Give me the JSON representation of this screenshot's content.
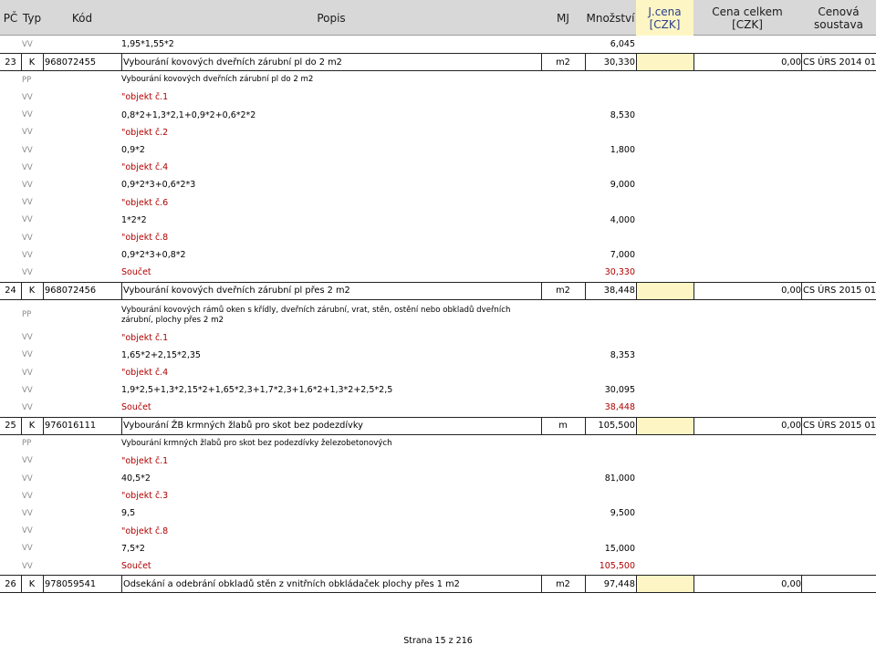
{
  "header": {
    "pc": "PČ",
    "typ": "Typ",
    "kod": "Kód",
    "popis": "Popis",
    "mj": "MJ",
    "mnozstvi": "Množství",
    "jcena": [
      "J.cena",
      "[CZK]"
    ],
    "cena_celkem": [
      "Cena celkem",
      "[CZK]"
    ],
    "cenova_soustava": [
      "Cenová",
      "soustava"
    ]
  },
  "rows": [
    {
      "kind": "vv",
      "tag": "VV",
      "text": "1,95*1,55*2",
      "qty": "6,045"
    },
    {
      "kind": "item",
      "pc": "23",
      "typ": "K",
      "kod": "968072455",
      "popis": "Vybourání kovových dveřních zárubní pl do 2 m2",
      "mj": "m2",
      "qty": "30,330",
      "total": "0,00",
      "system": "CS ÚRS 2014 01"
    },
    {
      "kind": "pp",
      "tag": "PP",
      "text": "Vybourání kovových dveřních zárubní pl do 2 m2"
    },
    {
      "kind": "obj",
      "tag": "VV",
      "text": "\"objekt č.1"
    },
    {
      "kind": "vv",
      "tag": "VV",
      "text": "0,8*2+1,3*2,1+0,9*2+0,6*2*2",
      "qty": "8,530"
    },
    {
      "kind": "obj",
      "tag": "VV",
      "text": "\"objekt č.2"
    },
    {
      "kind": "vv",
      "tag": "VV",
      "text": "0,9*2",
      "qty": "1,800"
    },
    {
      "kind": "obj",
      "tag": "VV",
      "text": "\"objekt č.4"
    },
    {
      "kind": "vv",
      "tag": "VV",
      "text": "0,9*2*3+0,6*2*3",
      "qty": "9,000"
    },
    {
      "kind": "obj",
      "tag": "VV",
      "text": "\"objekt č.6"
    },
    {
      "kind": "vv",
      "tag": "VV",
      "text": "1*2*2",
      "qty": "4,000"
    },
    {
      "kind": "obj",
      "tag": "VV",
      "text": "\"objekt č.8"
    },
    {
      "kind": "vv",
      "tag": "VV",
      "text": "0,9*2*3+0,8*2",
      "qty": "7,000"
    },
    {
      "kind": "sum",
      "tag": "VV",
      "text": "Součet",
      "qty": "30,330"
    },
    {
      "kind": "item",
      "pc": "24",
      "typ": "K",
      "kod": "968072456",
      "popis": "Vybourání kovových dveřních zárubní pl přes 2 m2",
      "mj": "m2",
      "qty": "38,448",
      "total": "0,00",
      "system": "CS ÚRS 2015 01"
    },
    {
      "kind": "pp2",
      "tag": "PP",
      "text": "Vybourání kovových rámů oken s křídly, dveřních zárubní, vrat, stěn, ostění nebo obkladů dveřních zárubní, plochy přes 2 m2"
    },
    {
      "kind": "obj",
      "tag": "VV",
      "text": "\"objekt č.1"
    },
    {
      "kind": "vv",
      "tag": "VV",
      "text": "1,65*2+2,15*2,35",
      "qty": "8,353"
    },
    {
      "kind": "obj",
      "tag": "VV",
      "text": "\"objekt č.4"
    },
    {
      "kind": "vv",
      "tag": "VV",
      "text": "1,9*2,5+1,3*2,15*2+1,65*2,3+1,7*2,3+1,6*2+1,3*2+2,5*2,5",
      "qty": "30,095"
    },
    {
      "kind": "sum",
      "tag": "VV",
      "text": "Součet",
      "qty": "38,448"
    },
    {
      "kind": "item",
      "pc": "25",
      "typ": "K",
      "kod": "976016111",
      "popis": "Vybourání ŽB krmných žlabů pro skot bez podezdívky",
      "mj": "m",
      "qty": "105,500",
      "total": "0,00",
      "system": "CS ÚRS 2015 01"
    },
    {
      "kind": "pp",
      "tag": "PP",
      "text": "Vybourání krmných žlabů pro skot bez podezdívky železobetonových"
    },
    {
      "kind": "obj",
      "tag": "VV",
      "text": "\"objekt č.1"
    },
    {
      "kind": "vv",
      "tag": "VV",
      "text": "40,5*2",
      "qty": "81,000"
    },
    {
      "kind": "obj",
      "tag": "VV",
      "text": "\"objekt č.3"
    },
    {
      "kind": "vv",
      "tag": "VV",
      "text": "9,5",
      "qty": "9,500"
    },
    {
      "kind": "obj",
      "tag": "VV",
      "text": "\"objekt č.8"
    },
    {
      "kind": "vv",
      "tag": "VV",
      "text": "7,5*2",
      "qty": "15,000"
    },
    {
      "kind": "sum",
      "tag": "VV",
      "text": "Součet",
      "qty": "105,500"
    },
    {
      "kind": "item",
      "pc": "26",
      "typ": "K",
      "kod": "978059541",
      "popis": "Odsekání a odebrání obkladů stěn z vnitřních obkládaček plochy přes 1 m2",
      "mj": "m2",
      "qty": "97,448",
      "total": "0,00",
      "system": ""
    }
  ],
  "footer": {
    "page": "Strana 15 z 216"
  }
}
